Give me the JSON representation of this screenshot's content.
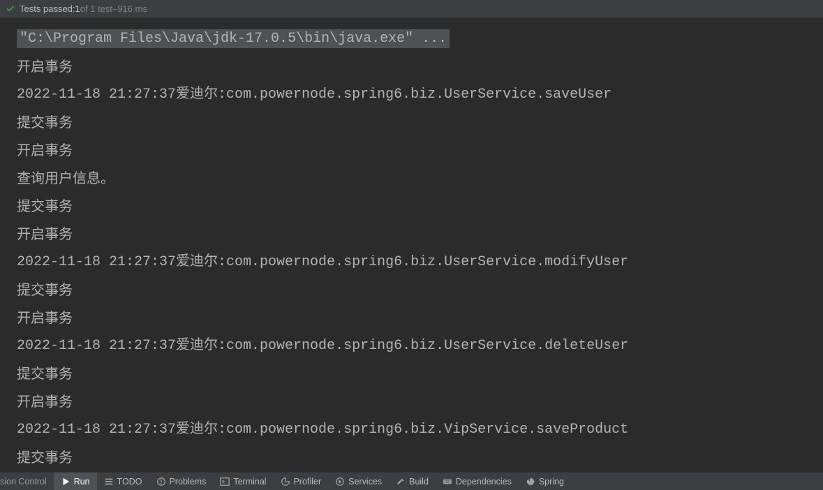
{
  "topbar": {
    "status_prefix": "Tests passed: ",
    "passed_count": "1",
    "of_text": " of 1 test ",
    "dash": "– ",
    "duration": "916 ms"
  },
  "console": {
    "cmd_line": "\"C:\\Program Files\\Java\\jdk-17.0.5\\bin\\java.exe\" ...",
    "lines": [
      "开启事务",
      "2022-11-18 21:27:37爱迪尔:com.powernode.spring6.biz.UserService.saveUser",
      "提交事务",
      "开启事务",
      "查询用户信息。",
      "提交事务",
      "开启事务",
      "2022-11-18 21:27:37爱迪尔:com.powernode.spring6.biz.UserService.modifyUser",
      "提交事务",
      "开启事务",
      "2022-11-18 21:27:37爱迪尔:com.powernode.spring6.biz.UserService.deleteUser",
      "提交事务",
      "开启事务",
      "2022-11-18 21:27:37爱迪尔:com.powernode.spring6.biz.VipService.saveProduct",
      "提交事务"
    ]
  },
  "bottombar": {
    "left_truncated": "sion Control",
    "tabs": [
      {
        "label": "Run",
        "icon": "play",
        "active": true
      },
      {
        "label": "TODO",
        "icon": "list",
        "active": false
      },
      {
        "label": "Problems",
        "icon": "warning",
        "active": false
      },
      {
        "label": "Terminal",
        "icon": "terminal",
        "active": false
      },
      {
        "label": "Profiler",
        "icon": "profiler",
        "active": false
      },
      {
        "label": "Services",
        "icon": "services",
        "active": false
      },
      {
        "label": "Build",
        "icon": "build",
        "active": false
      },
      {
        "label": "Dependencies",
        "icon": "deps",
        "active": false
      },
      {
        "label": "Spring",
        "icon": "spring",
        "active": false
      }
    ]
  }
}
